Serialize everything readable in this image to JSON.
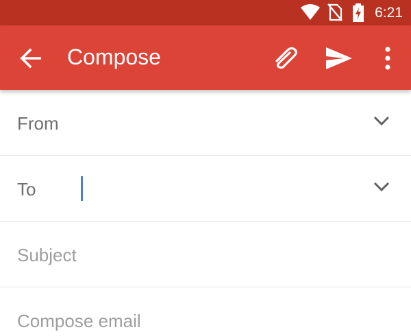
{
  "status_bar": {
    "time": "6:21",
    "icons": [
      "wifi-icon",
      "no-sim-icon",
      "battery-charging-icon"
    ]
  },
  "app_bar": {
    "title": "Compose",
    "icons": [
      "back-arrow-icon",
      "attachment-icon",
      "send-icon",
      "more-vert-icon"
    ],
    "color": "#db4437"
  },
  "fields": {
    "from_label": "From",
    "to_label": "To",
    "subject_placeholder": "Subject",
    "body_placeholder": "Compose email"
  },
  "colors": {
    "status_bar": "#b93221",
    "cursor": "#4a7fd0"
  }
}
